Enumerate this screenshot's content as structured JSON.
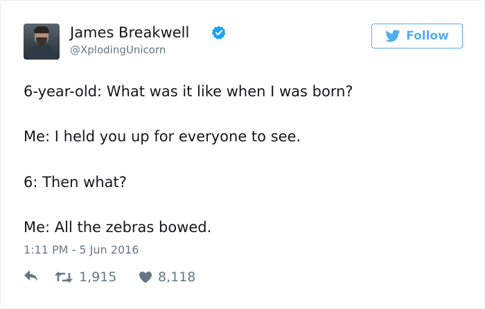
{
  "author": {
    "name": "James Breakwell",
    "handle": "@XplodingUnicorn",
    "verified": true,
    "avatar": "avatar-photo"
  },
  "follow_button": {
    "label": "Follow",
    "icon": "twitter-bird-icon"
  },
  "tweet": {
    "lines": [
      "6-year-old: What was it like when I was born?",
      "Me: I held you up for everyone to see.",
      "6: Then what?",
      "Me: All the zebras bowed."
    ],
    "timestamp": "1:11 PM - 5 Jun 2016"
  },
  "actions": {
    "reply_icon": "reply-icon",
    "retweet_icon": "retweet-icon",
    "retweets": "1,915",
    "like_icon": "heart-icon",
    "likes": "8,118"
  },
  "colors": {
    "accent": "#55acee",
    "secondary_text": "#657786",
    "primary_text": "#14171a",
    "verified_badge": "#1da1f2"
  }
}
